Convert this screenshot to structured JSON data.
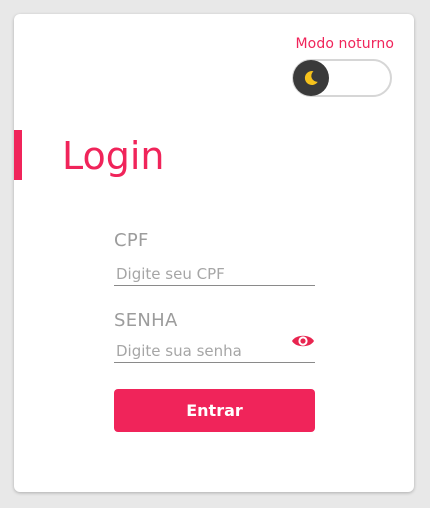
{
  "theme": {
    "accent": "#f0245a",
    "night_mode_label": "Modo noturno",
    "night_mode_on": false,
    "toggle_icon": "moon-icon"
  },
  "login": {
    "title": "Login",
    "cpf_label": "CPF",
    "cpf_placeholder": "Digite seu CPF",
    "cpf_value": "",
    "password_label": "SENHA",
    "password_placeholder": "Digite sua senha",
    "password_value": "",
    "show_password_icon": "eye-icon",
    "submit_label": "Entrar"
  }
}
